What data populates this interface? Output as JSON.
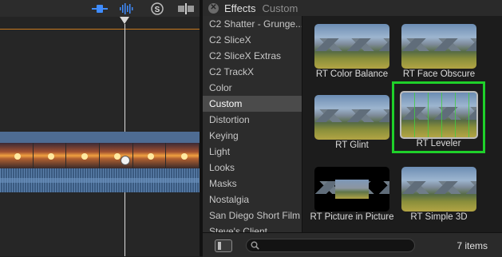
{
  "colors": {
    "selection_outline": "#1fd02a",
    "clip_blue": "#4e6c93",
    "timeline_accent": "#c97a1f",
    "toolbar_icon_blue": "#3f8cff"
  },
  "timeline": {
    "toolbar_icons": [
      "video-clip-toggle-icon",
      "audio-waveform-icon",
      "solo-icon",
      "snapping-icon"
    ]
  },
  "effects_browser": {
    "title": "Effects",
    "subtitle": "Custom",
    "categories": [
      {
        "label": "C2 Shatter - Grunge..."
      },
      {
        "label": "C2 SliceX"
      },
      {
        "label": "C2 SliceX Extras"
      },
      {
        "label": "C2 TrackX"
      },
      {
        "label": "Color"
      },
      {
        "label": "Custom"
      },
      {
        "label": "Distortion"
      },
      {
        "label": "Keying"
      },
      {
        "label": "Light"
      },
      {
        "label": "Looks"
      },
      {
        "label": "Masks"
      },
      {
        "label": "Nostalgia"
      },
      {
        "label": "San Diego Short Film"
      },
      {
        "label": "Steve's Client"
      }
    ],
    "selected_category": "Custom",
    "effects": [
      {
        "label": "RT Color Balance"
      },
      {
        "label": "RT Face Obscure"
      },
      {
        "label": "RT Glint"
      },
      {
        "label": "RT Leveler"
      },
      {
        "label": "RT Picture in Picture"
      },
      {
        "label": "RT Simple 3D"
      }
    ],
    "selected_effect": "RT Leveler",
    "search": {
      "value": "",
      "placeholder": ""
    },
    "item_count": "7 items"
  }
}
